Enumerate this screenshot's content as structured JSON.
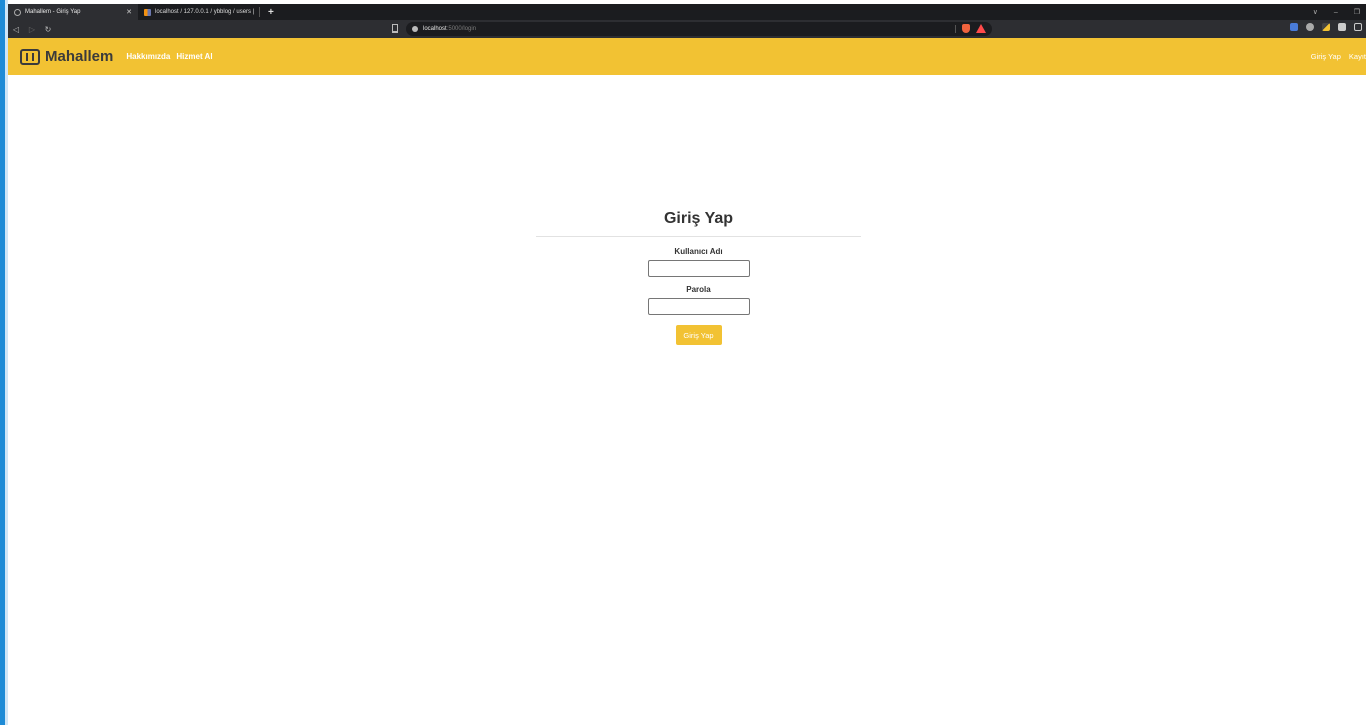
{
  "browser": {
    "tabs": [
      {
        "label": "Mahallem - Giriş Yap",
        "active": true
      },
      {
        "label": "localhost / 127.0.0.1 / ybblog / users |",
        "active": false
      }
    ],
    "new_tab": "+",
    "url_host": "localhost",
    "url_path": ":5000/login",
    "window_controls": [
      "∨",
      "–",
      "❐"
    ]
  },
  "navbar": {
    "brand": "Mahallem",
    "links": [
      "Hakkımızda",
      "Hizmet Al"
    ],
    "right_links": [
      "Giriş Yap",
      "Kayıt"
    ]
  },
  "login": {
    "title": "Giriş Yap",
    "username_label": "Kullanıcı Adı",
    "password_label": "Parola",
    "submit_label": "Giriş Yap"
  },
  "colors": {
    "accent": "#f2c233",
    "browser_dark": "#1b1c1f"
  }
}
